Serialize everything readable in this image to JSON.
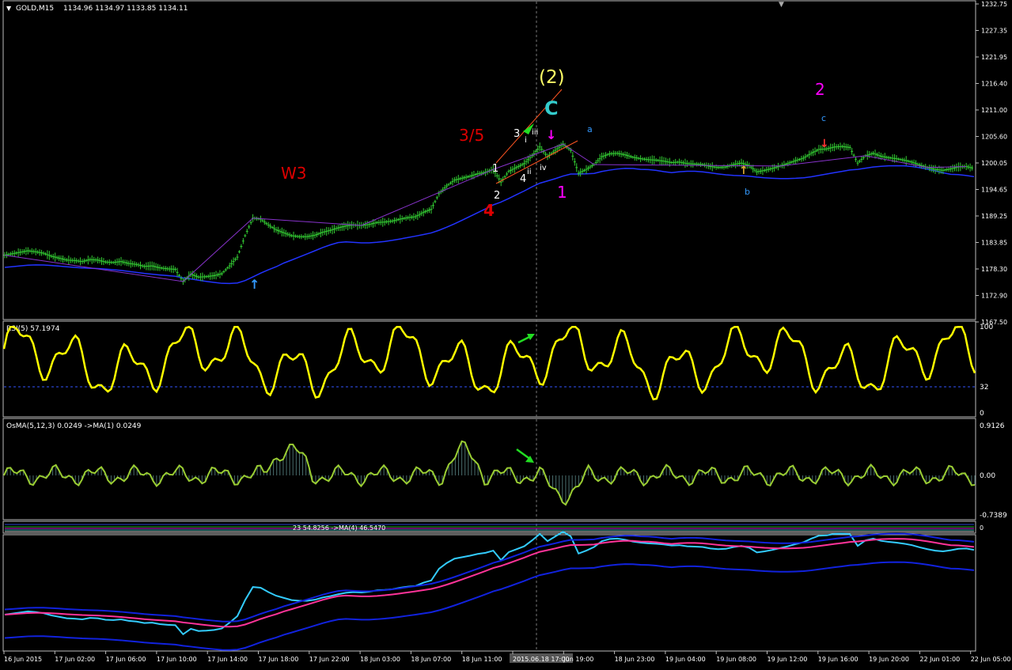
{
  "header": {
    "symbol": "GOLD,M15",
    "ohlc": "1134.96 1134.97 1133.85 1134.11"
  },
  "price_axis": [
    "1232.75",
    "1227.35",
    "1221.95",
    "1216.40",
    "1211.00",
    "1205.60",
    "1200.05",
    "1194.65",
    "1189.25",
    "1183.85",
    "1178.30",
    "1172.90",
    "1167.50"
  ],
  "rsi": {
    "label": "RSI(5) 57.1974",
    "levels": [
      "100",
      "32",
      "0"
    ]
  },
  "osma": {
    "label": "OsMA(5,12,3) 0.0249  ->MA(1) 0.0249",
    "levels": [
      "0.9126",
      "0.00",
      "-0.7389"
    ]
  },
  "mini_panel": {
    "label": "23 54.8256  ->MA(4) 46.5470",
    "axis": "0"
  },
  "time_axis": [
    "16 Jun 2015",
    "17 Jun 02:00",
    "17 Jun 06:00",
    "17 Jun 10:00",
    "17 Jun 14:00",
    "17 Jun 18:00",
    "17 Jun 22:00",
    "18 Jun 03:00",
    "18 Jun 07:00",
    "18 Jun 11:00",
    "2015.06.18 17:00",
    "Jun 19:00",
    "18 Jun 23:00",
    "19 Jun 04:00",
    "19 Jun 08:00",
    "19 Jun 12:00",
    "19 Jun 16:00",
    "19 Jun 20:00",
    "22 Jun 01:00",
    "22 Jun 05:00"
  ],
  "annotations": {
    "w3": "W3",
    "w35": "3/5",
    "w4": "4",
    "w2paren": "(2)",
    "wC": "C",
    "w1big": "1",
    "w2big": "2",
    "sub1": "1",
    "sub2": "2",
    "sub3": "3",
    "sub4": "4",
    "rom_i": "i",
    "rom_ii": "ii",
    "rom_iii": "iii",
    "rom_iv": "iv",
    "a": "a",
    "b": "b",
    "c": "c"
  },
  "colors": {
    "candle": "#33cc33",
    "rsi": "#ffff00",
    "osma_line": "#9acd32",
    "ma": "#2233ff",
    "magenta": "#ff00ff",
    "red": "#dd0000",
    "cyan": "#33cccc",
    "gold": "#ffff66",
    "blue_label": "#3399ff"
  },
  "chart_data": {
    "type": "line",
    "title": "GOLD,M15",
    "xlabel": "",
    "ylabel": "",
    "ylim": [
      1167.5,
      1232.75
    ],
    "series": [
      {
        "values": [
          1181.2,
          1181.5,
          1181.8,
          1182.1,
          1181.9,
          1181.6,
          1181.0,
          1180.6,
          1180.2,
          1180.1,
          1179.9,
          1180.3,
          1180.2,
          1179.8,
          1179.7,
          1179.9,
          1179.5,
          1179.3,
          1178.9,
          1179.0,
          1178.6,
          1178.4,
          1178.3,
          1175.8,
          1177.3,
          1176.7,
          1176.8,
          1177.0,
          1177.4,
          1179.0,
          1180.8,
          1185.2,
          1188.8,
          1188.6,
          1187.4,
          1186.4,
          1185.8,
          1185.2,
          1185.0,
          1185.0,
          1185.3,
          1185.9,
          1186.3,
          1186.8,
          1187.2,
          1187.4,
          1187.3,
          1187.5,
          1187.9,
          1188.0,
          1188.2,
          1188.6,
          1188.9,
          1189.1,
          1190.0,
          1190.6,
          1193.8,
          1195.4,
          1196.6,
          1197.0,
          1197.4,
          1197.9,
          1198.2,
          1198.8,
          1196.2,
          1198.4,
          1199.2,
          1200.0,
          1201.6,
          1203.4,
          1201.4,
          1202.7,
          1204.0,
          1202.7,
          1198.0,
          1198.8,
          1199.8,
          1201.4,
          1202.0,
          1202.1,
          1201.8,
          1201.3,
          1201.0,
          1200.8,
          1200.7,
          1200.5,
          1200.2,
          1200.3,
          1200.0,
          1199.9,
          1199.8,
          1199.4,
          1199.2,
          1199.3,
          1199.8,
          1200.1,
          1199.6,
          1198.3,
          1198.6,
          1199.0,
          1199.5,
          1200.0,
          1200.6,
          1201.1,
          1202.1,
          1202.9,
          1203.0,
          1203.4,
          1203.5,
          1203.3,
          1200.1,
          1201.6,
          1202.1,
          1201.5,
          1201.2,
          1201.0,
          1200.7,
          1200.3,
          1199.7,
          1199.2,
          1198.8,
          1198.6,
          1198.9,
          1199.3,
          1199.4,
          1199.0
        ]
      }
    ]
  }
}
